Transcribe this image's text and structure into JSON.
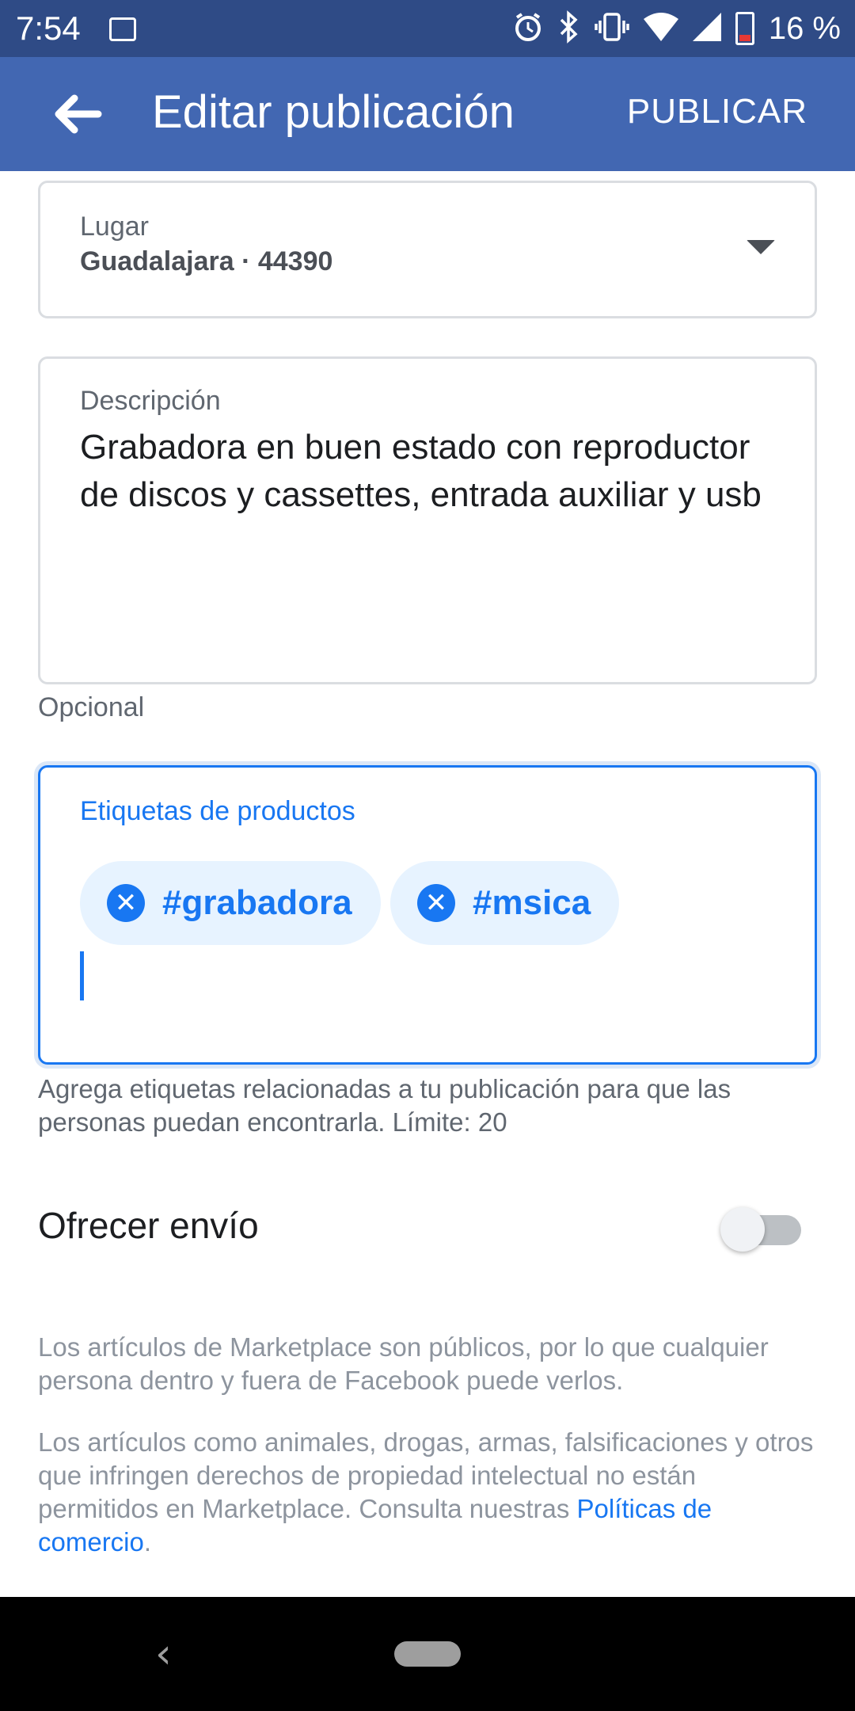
{
  "status_bar": {
    "time": "7:54",
    "battery_percent": "16 %",
    "icons": [
      "image-icon",
      "alarm-icon",
      "bluetooth-icon",
      "vibrate-icon",
      "wifi-icon",
      "signal-icon",
      "battery-icon"
    ]
  },
  "app_bar": {
    "title": "Editar publicación",
    "publish_label": "PUBLICAR",
    "back_icon": "arrow-left-icon"
  },
  "place": {
    "label": "Lugar",
    "value": "Guadalajara · 44390"
  },
  "description": {
    "label": "Descripción",
    "value": "Grabadora en buen estado con reproductor de discos y cassettes, entrada auxiliar y usb",
    "helper": "Opcional"
  },
  "tags": {
    "label": "Etiquetas de productos",
    "chips": [
      {
        "text": "#grabadora"
      },
      {
        "text": "#msica"
      }
    ],
    "helper": "Agrega etiquetas relacionadas a tu publicación para que las personas puedan encontrarla. Límite: 20"
  },
  "shipping": {
    "label": "Ofrecer envío",
    "enabled": false
  },
  "notices": {
    "public": "Los artículos de Marketplace son públicos, por lo que cualquier persona dentro y fuera de Facebook puede verlos.",
    "restricted_prefix": "Los artículos como animales, drogas, armas, falsificaciones y otros que infringen derechos de propiedad intelectual no están permitidos en Marketplace. Consulta nuestras",
    "policy_link": "Políticas de comercio",
    "suffix": "."
  },
  "colors": {
    "app_bar": "#4267b2",
    "status_bar": "#2f4b86",
    "accent": "#1877f2"
  }
}
